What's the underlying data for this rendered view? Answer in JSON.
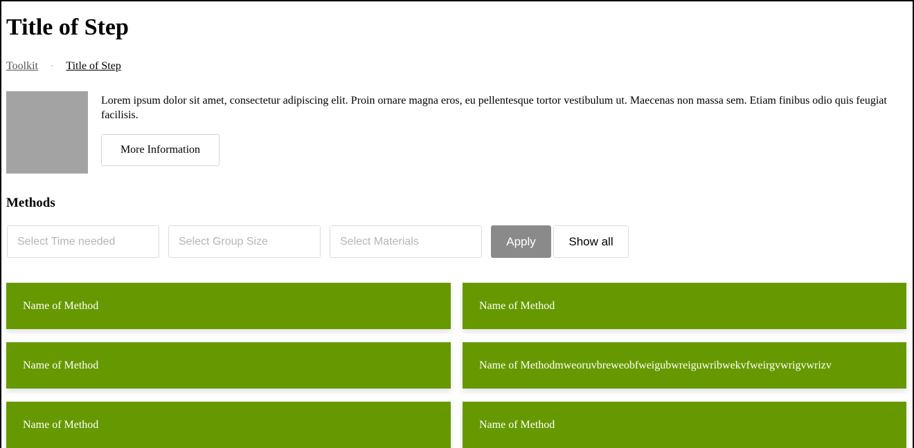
{
  "page": {
    "title": "Title of Step"
  },
  "breadcrumb": {
    "parent": "Toolkit",
    "separator": "·",
    "current": "Title of Step"
  },
  "intro": {
    "text": "Lorem ipsum dolor sit amet, consectetur adipiscing elit. Proin ornare magna eros, eu pellentesque tortor vestibulum ut. Maecenas non massa sem. Etiam finibus odio quis feugiat facilisis.",
    "more_button_label": "More Information"
  },
  "methods": {
    "heading": "Methods",
    "filters": {
      "time_placeholder": "Select Time needed",
      "group_placeholder": "Select Group Size",
      "materials_placeholder": "Select Materials",
      "apply_label": "Apply",
      "show_all_label": "Show all"
    },
    "items": [
      {
        "name": "Name of Method"
      },
      {
        "name": "Name of Method"
      },
      {
        "name": "Name of Method"
      },
      {
        "name": "Name of Methodmweoruvbreweobfweigubwreiguwribwekvfweirgvwrigvwrizv"
      },
      {
        "name": "Name of Method"
      },
      {
        "name": "Name of Method"
      }
    ],
    "card_color": "#669900"
  },
  "colors": {
    "thumbnail": "#a3a3a3",
    "apply_button": "#8a8a8a"
  }
}
